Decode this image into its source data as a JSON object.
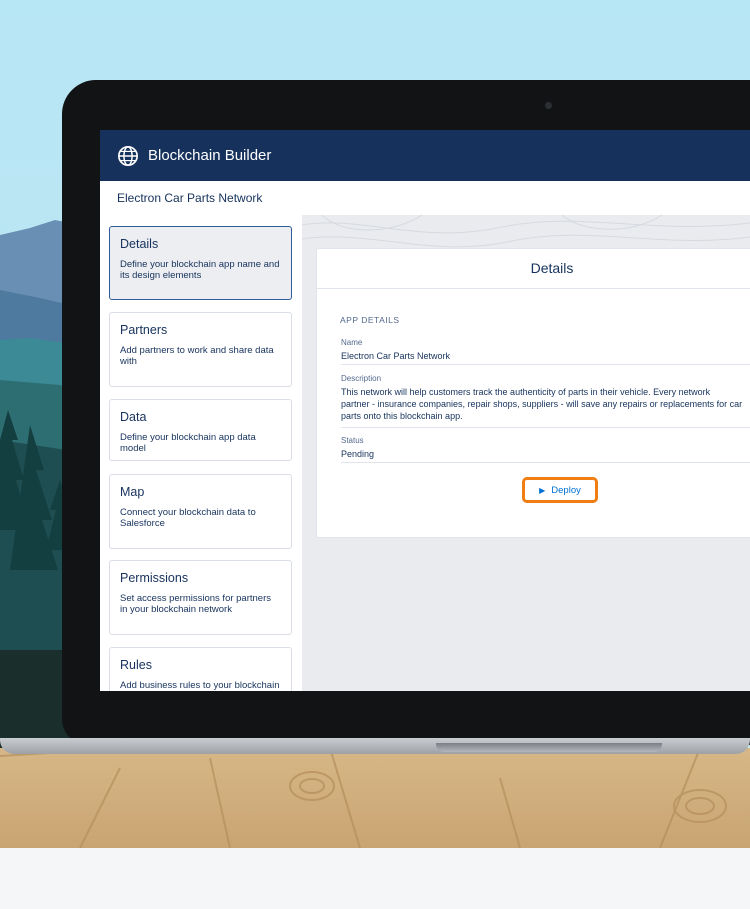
{
  "colors": {
    "header": "#16325c",
    "accent": "#0070d2",
    "highlight": "#f07e12"
  },
  "app": {
    "title": "Blockchain Builder",
    "icon": "globe-icon"
  },
  "network": {
    "title": "Electron Car Parts Network"
  },
  "steps": [
    {
      "title": "Details",
      "description": "Define your blockchain app name and its design elements",
      "active": true
    },
    {
      "title": "Partners",
      "description": "Add partners to work and share data with"
    },
    {
      "title": "Data",
      "description": "Define your blockchain app data model"
    },
    {
      "title": "Map",
      "description": "Connect your blockchain data to Salesforce"
    },
    {
      "title": "Permissions",
      "description": "Set access permissions for partners in your blockchain network"
    },
    {
      "title": "Rules",
      "description": "Add business rules to your blockchain"
    }
  ],
  "details": {
    "title": "Details",
    "section": "APP DETAILS",
    "name_label": "Name",
    "name_value": "Electron Car Parts Network",
    "description_label": "Description",
    "description_line1": "This network will help customers track the authenticity of parts in their vehicle. Every network",
    "description_line2": "partner - insurance companies, repair shops, suppliers - will save any repairs or replacements for car",
    "description_line3": "parts onto this blockchain app.",
    "status_label": "Status",
    "status_value": "Pending",
    "deploy_label": "Deploy",
    "deploy_icon": "play-icon"
  }
}
